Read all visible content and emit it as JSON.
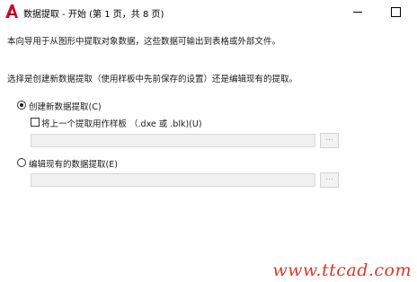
{
  "window": {
    "title": "数据提取 - 开始 (第 1 页，共 8 页)",
    "app_icon": "autocad-icon",
    "accent_color": "#c8102e"
  },
  "intro": {
    "line1": "本向导用于从图形中提取对象数据，这些数据可输出到表格或外部文件。",
    "line2": "选择是创建新数据提取（使用样板中先前保存的设置）还是编辑现有的提取。"
  },
  "options": {
    "create_new": {
      "label": "创建新数据提取(C)",
      "checked": true,
      "template_checkbox": {
        "label": "将上一个提取用作样板 （.dxe 或 .blk)(U)",
        "checked": false
      },
      "path_value": "",
      "browse_label": "..."
    },
    "edit_existing": {
      "label": "编辑现有的数据提取(E)",
      "checked": false,
      "path_value": "",
      "browse_label": "..."
    }
  },
  "watermark": "www.ttcad.com"
}
